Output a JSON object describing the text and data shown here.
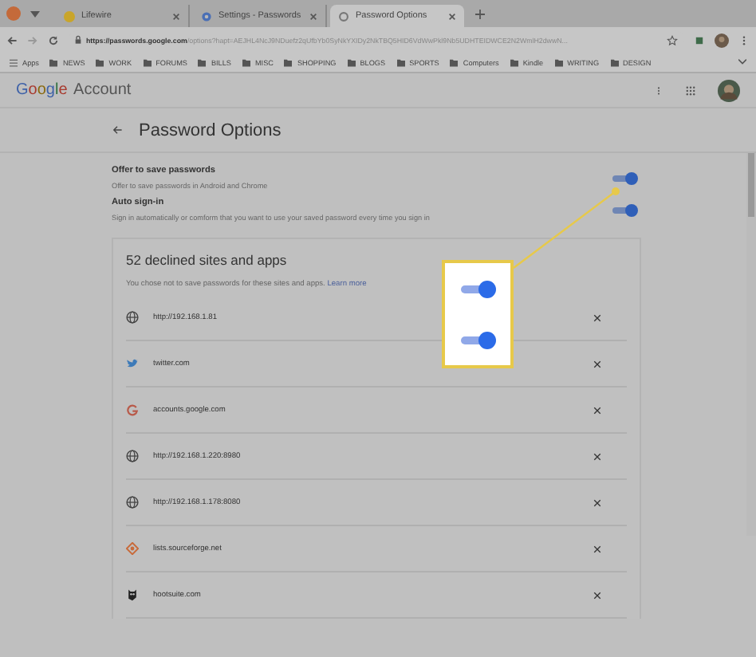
{
  "browser": {
    "tabs": [
      {
        "label": "Lifewire",
        "selected": false,
        "kind": "lifewire"
      },
      {
        "label": "Settings - Passwords",
        "selected": false,
        "kind": "settings"
      },
      {
        "label": "Password Options",
        "selected": true,
        "kind": "google"
      }
    ],
    "url_host": "https://passwords.google.com",
    "url_path": "/options?hapt=AEJHL4NcJ9NDuefz2qUfbYb0SyNkYXIDy2NkTBQ5HID6VdWwPkl9Nb5UDHTEIDWCE2N2WmlH2dwwN...",
    "bookmarks": [
      "Apps",
      "NEWS",
      "WORK",
      "FORUMS",
      "BILLS",
      "MISC",
      "SHOPPING",
      "BLOGS",
      "SPORTS",
      "Computers",
      "Kindle",
      "WRITING",
      "DESIGN"
    ]
  },
  "header": {
    "logo": "Google",
    "product": "Account"
  },
  "page_title": "Password Options",
  "settings": [
    {
      "label": "Offer to save passwords",
      "description": "Offer to save passwords in Android and Chrome",
      "on": true
    },
    {
      "label": "Auto sign-in",
      "description": "Sign in automatically or comform that you want to use your saved password every time you sign in",
      "on": true
    }
  ],
  "declined": {
    "title": "52 declined sites and apps",
    "description": "You chose not to save passwords for these sites and apps.",
    "link": "Learn more",
    "sites": [
      {
        "name": "http://192.168.1.81",
        "kind": "globe"
      },
      {
        "name": "twitter.com",
        "kind": "bird"
      },
      {
        "name": "accounts.google.com",
        "kind": "g"
      },
      {
        "name": "http://192.168.1.220:8980",
        "kind": "globe"
      },
      {
        "name": "http://192.168.1.178:8080",
        "kind": "globe"
      },
      {
        "name": "lists.sourceforge.net",
        "kind": "diamond"
      },
      {
        "name": "hootsuite.com",
        "kind": "owl"
      }
    ]
  }
}
